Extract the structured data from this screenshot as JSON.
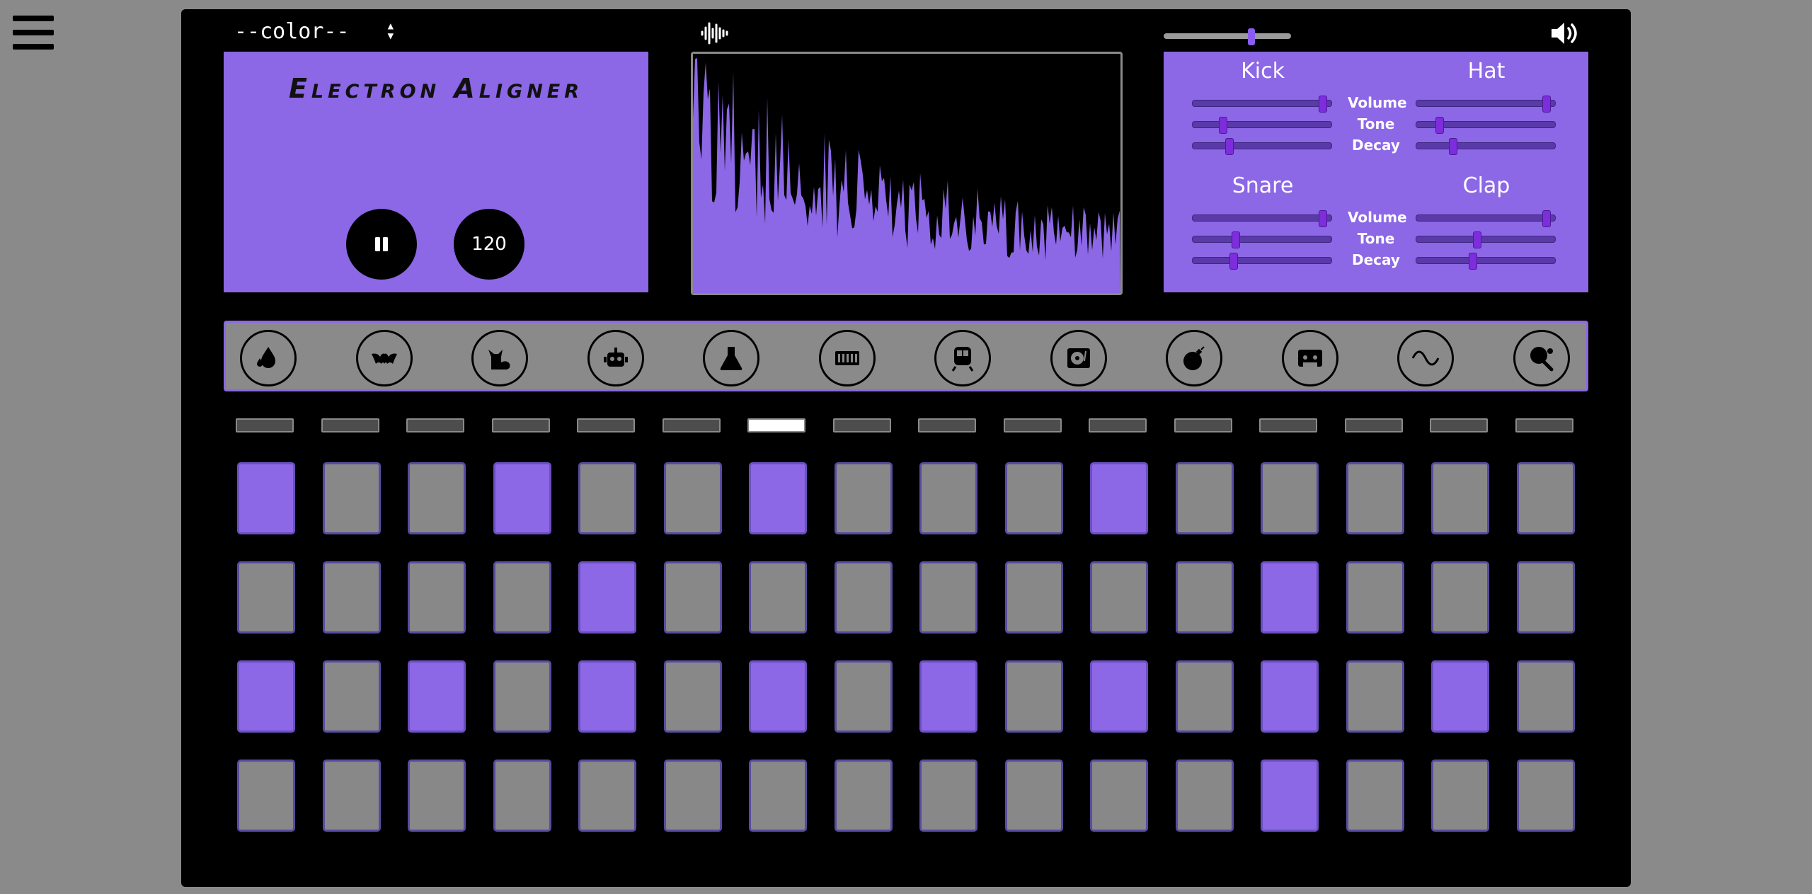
{
  "menu": {
    "icon": "hamburger-menu-icon"
  },
  "topbar": {
    "color_select": "--color--",
    "waveform_icon": "waveform-icon",
    "master_volume": 0.7,
    "speaker_icon": "speaker-volume-icon"
  },
  "title_panel": {
    "title": "Electron Aligner",
    "pause_icon": "pause-icon",
    "tempo": "120"
  },
  "instruments": [
    {
      "name": "Kick",
      "volume": 0.95,
      "tone": 0.2,
      "decay": 0.25
    },
    {
      "name": "Hat",
      "volume": 0.95,
      "tone": 0.15,
      "decay": 0.25
    },
    {
      "name": "Snare",
      "volume": 0.95,
      "tone": 0.3,
      "decay": 0.28
    },
    {
      "name": "Clap",
      "volume": 0.95,
      "tone": 0.43,
      "decay": 0.4
    }
  ],
  "param_labels": [
    "Volume",
    "Tone",
    "Decay"
  ],
  "kits": [
    "water-drops-icon",
    "bat-icon",
    "cat-icon",
    "robot-icon",
    "flask-icon",
    "keyboard-icon",
    "train-icon",
    "turntable-icon",
    "bomb-icon",
    "cassette-icon",
    "sine-wave-icon",
    "ping-pong-icon"
  ],
  "colors": {
    "accent": "#8c67e6",
    "pad_off": "#888888",
    "background": "#000000"
  },
  "current_step": 6,
  "pattern": [
    [
      1,
      0,
      0,
      1,
      0,
      0,
      1,
      0,
      0,
      0,
      1,
      0,
      0,
      0,
      0,
      0
    ],
    [
      0,
      0,
      0,
      0,
      1,
      0,
      0,
      0,
      0,
      0,
      0,
      0,
      1,
      0,
      0,
      0
    ],
    [
      1,
      0,
      1,
      0,
      1,
      0,
      1,
      0,
      1,
      0,
      1,
      0,
      1,
      0,
      1,
      0
    ],
    [
      0,
      0,
      0,
      0,
      0,
      0,
      0,
      0,
      0,
      0,
      0,
      0,
      1,
      0,
      0,
      0
    ]
  ]
}
